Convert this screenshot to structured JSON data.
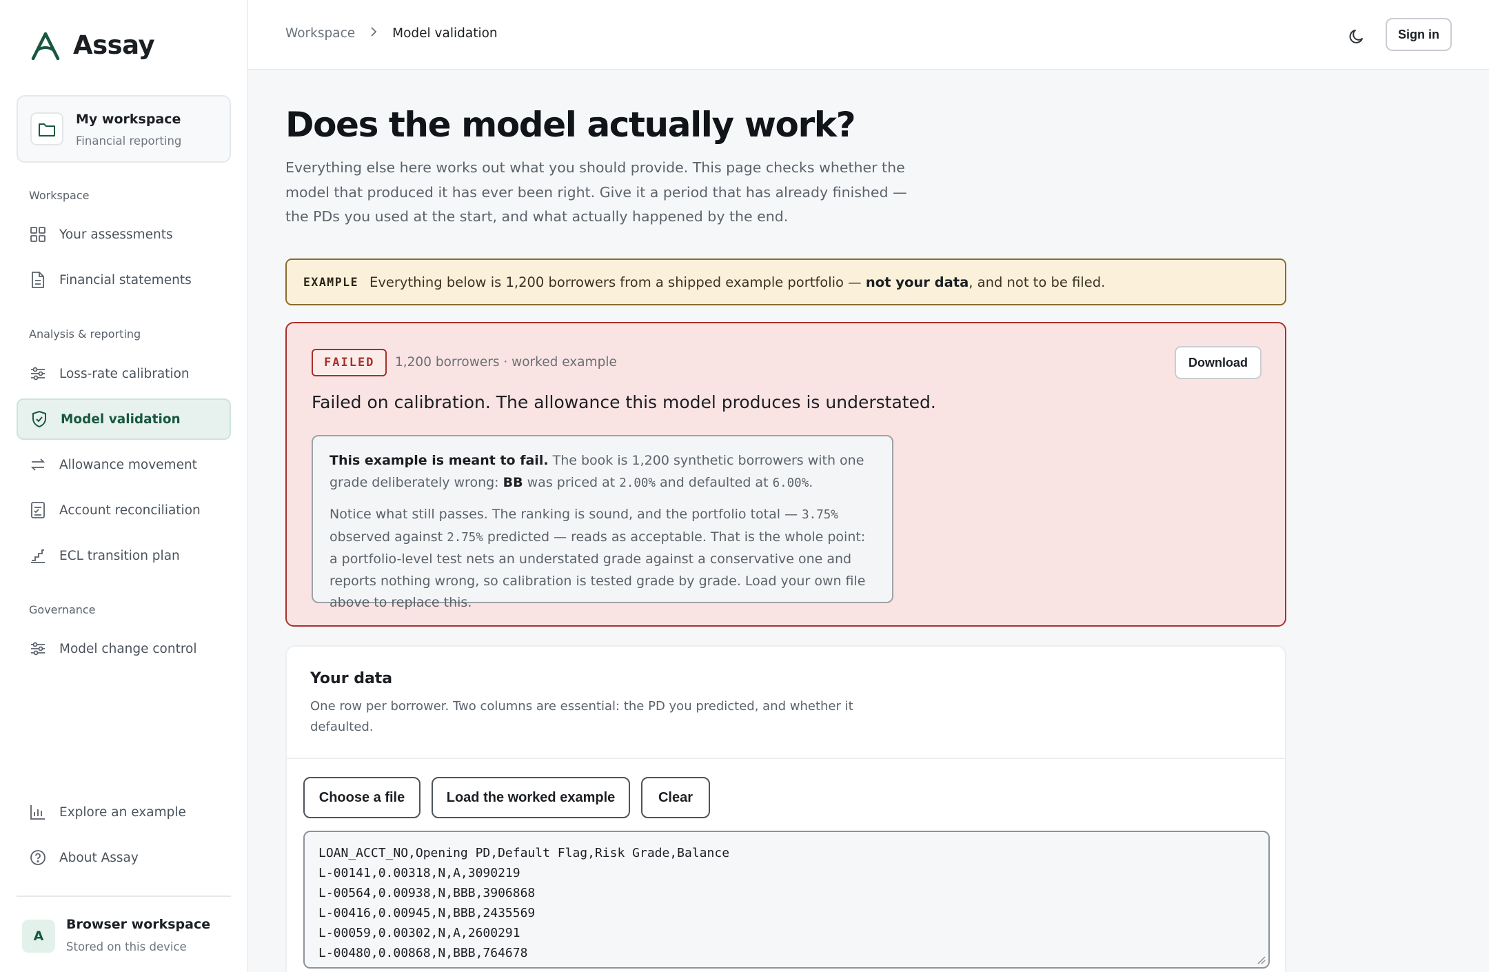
{
  "app": {
    "name": "Assay"
  },
  "workspace_card": {
    "title": "My workspace",
    "subtitle": "Financial reporting"
  },
  "sidebar": {
    "sections": [
      {
        "label": "Workspace"
      },
      {
        "label": "Analysis & reporting"
      },
      {
        "label": "Governance"
      }
    ],
    "items": [
      {
        "label": "Your assessments",
        "icon": "grid-icon"
      },
      {
        "label": "Financial statements",
        "icon": "document-icon"
      },
      {
        "label": "Loss-rate calibration",
        "icon": "sliders-icon"
      },
      {
        "label": "Model validation",
        "icon": "shield-check-icon",
        "active": true
      },
      {
        "label": "Allowance movement",
        "icon": "arrows-swap-icon"
      },
      {
        "label": "Account reconciliation",
        "icon": "checklist-icon"
      },
      {
        "label": "ECL transition plan",
        "icon": "steps-icon"
      },
      {
        "label": "Model change control",
        "icon": "sliders-icon"
      }
    ],
    "footer_items": [
      {
        "label": "Explore an example",
        "icon": "bar-chart-icon"
      },
      {
        "label": "About Assay",
        "icon": "help-circle-icon"
      }
    ],
    "browser_workspace": {
      "avatar": "A",
      "title": "Browser workspace",
      "subtitle": "Stored on this device"
    }
  },
  "topbar": {
    "breadcrumb": [
      "Workspace",
      "Model validation"
    ],
    "sign_in": "Sign in"
  },
  "page": {
    "title": "Does the model actually work?",
    "intro": "Everything else here works out what you should provide. This page checks whether the model that produced it has ever been right. Give it a period that has already finished — the PDs you used at the start, and what actually happened by the end."
  },
  "example_banner": {
    "tag": "EXAMPLE",
    "text_before": "Everything below is 1,200 borrowers from a shipped example portfolio — ",
    "text_bold": "not your data",
    "text_after": ", and not to be filed."
  },
  "result": {
    "status": "FAILED",
    "meta": "1,200 borrowers · worked example",
    "download": "Download",
    "headline": "Failed on calibration. The allowance this model produces is understated.",
    "note": {
      "p1_bold": "This example is meant to fail.",
      "p1_a": " The book is 1,200 synthetic borrowers with one grade deliberately wrong: ",
      "p1_grade": "BB",
      "p1_b": " was priced at ",
      "p1_pd": "2.00%",
      "p1_c": " and defaulted at ",
      "p1_dr": "6.00%",
      "p1_d": ".",
      "p2_a": "Notice what still passes. The ranking is sound, and the portfolio total — ",
      "p2_obs": "3.75%",
      "p2_b": " observed against ",
      "p2_pred": "2.75%",
      "p2_c": " predicted — reads as acceptable. That is the whole point: a portfolio-level test nets an understated grade against a conservative one and reports nothing wrong, so calibration is tested grade by grade. Load your own file above to replace this."
    }
  },
  "data_card": {
    "title": "Your data",
    "description": "One row per borrower. Two columns are essential: the PD you predicted, and whether it defaulted.",
    "buttons": {
      "choose": "Choose a file",
      "load": "Load the worked example",
      "clear": "Clear"
    },
    "csv": "LOAN_ACCT_NO,Opening PD,Default Flag,Risk Grade,Balance\nL-00141,0.00318,N,A,3090219\nL-00564,0.00938,N,BBB,3906868\nL-00416,0.00945,N,BBB,2435569\nL-00059,0.00302,N,A,2600291\nL-00480,0.00868,N,BBB,764678"
  },
  "colors": {
    "accent": "#17583f",
    "fail": "#a8302b",
    "example_bg": "#fbf0d9"
  }
}
